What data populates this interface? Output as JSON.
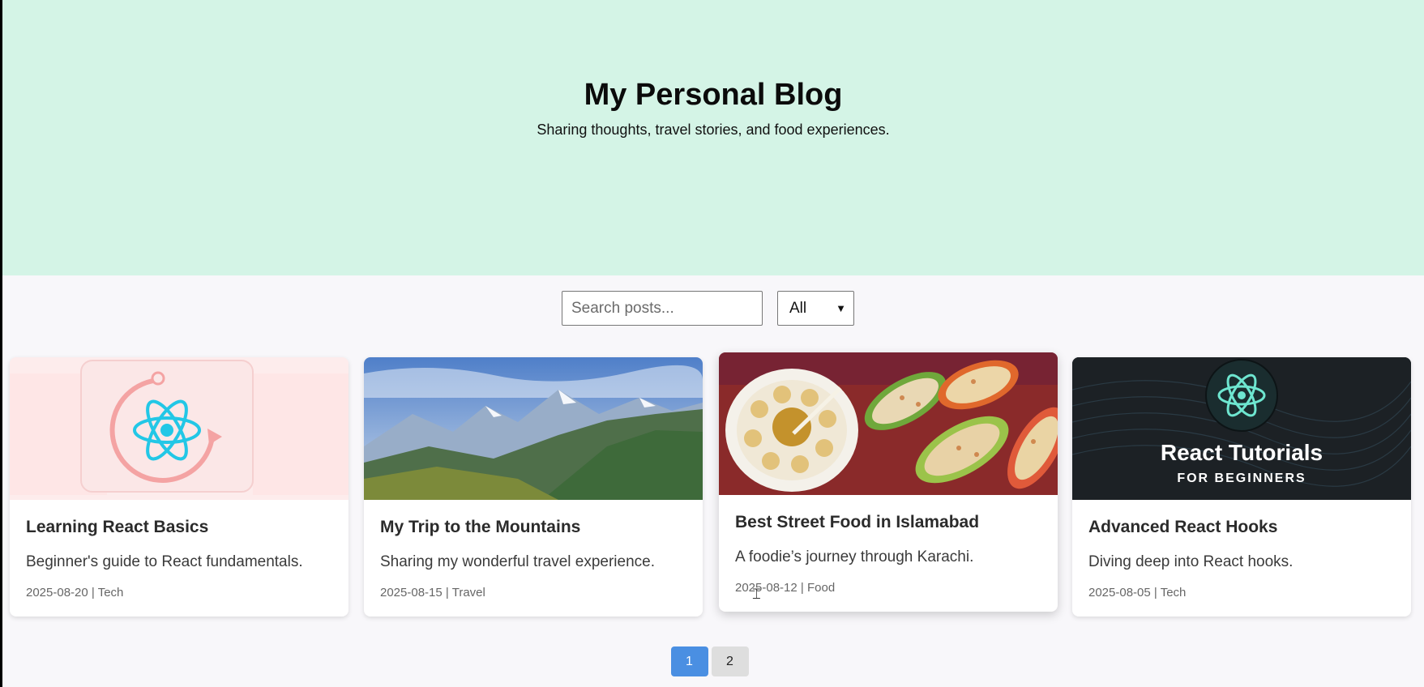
{
  "header": {
    "title": "My Personal Blog",
    "subtitle": "Sharing thoughts, travel stories, and food experiences."
  },
  "controls": {
    "search_placeholder": "Search posts...",
    "category_selected": "All"
  },
  "posts": [
    {
      "title": "Learning React Basics",
      "excerpt": "Beginner's guide to React fundamentals.",
      "date": "2025-08-20",
      "category": "Tech",
      "image": "react-logo-thumbnail"
    },
    {
      "title": "My Trip to the Mountains",
      "excerpt": "Sharing my wonderful travel experience.",
      "date": "2025-08-15",
      "category": "Travel",
      "image": "mountain-landscape-thumbnail"
    },
    {
      "title": "Best Street Food in Islamabad",
      "excerpt": "A foodie’s journey through Karachi.",
      "date": "2025-08-12",
      "category": "Food",
      "image": "street-food-thumbnail"
    },
    {
      "title": "Advanced React Hooks",
      "excerpt": "Diving deep into React hooks.",
      "date": "2025-08-05",
      "category": "Tech",
      "image": "react-tutorials-thumbnail",
      "image_text_line1": "React Tutorials",
      "image_text_line2": "FOR BEGINNERS"
    }
  ],
  "meta_separator": "|",
  "pagination": {
    "pages": [
      "1",
      "2"
    ],
    "current": "1"
  },
  "colors": {
    "hero_bg": "#d4f4e6",
    "page_bg": "#f8f7fa",
    "active_page": "#4a8fe2",
    "react_cyan": "#22d3ee"
  }
}
